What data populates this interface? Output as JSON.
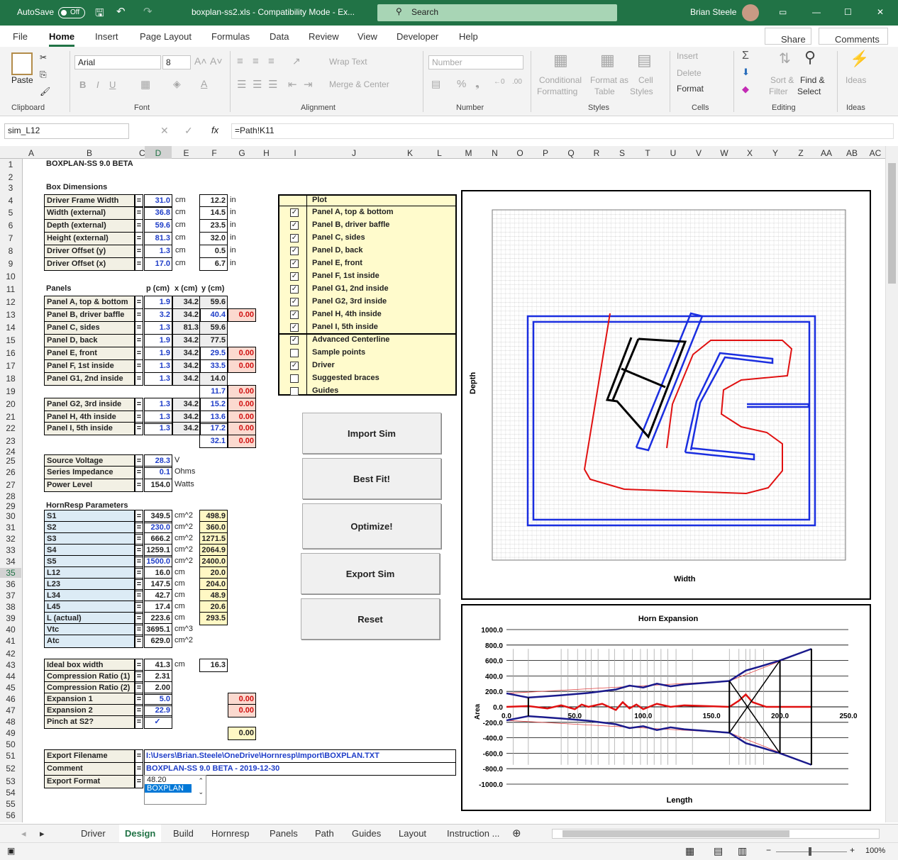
{
  "titlebar": {
    "autosave": "AutoSave",
    "toggle": "Off",
    "doc": "boxplan-ss2.xls  -  Compatibility Mode  -  Ex...",
    "search": "Search",
    "user": "Brian Steele"
  },
  "tabs": [
    "File",
    "Home",
    "Insert",
    "Page Layout",
    "Formulas",
    "Data",
    "Review",
    "View",
    "Developer",
    "Help"
  ],
  "share": "Share",
  "comments": "Comments",
  "ribbon": {
    "paste": "Paste",
    "font": "Arial",
    "size": "8",
    "number_format": "Number",
    "wrap": "Wrap Text",
    "merge": "Merge & Center",
    "cond": [
      "Conditional",
      "Formatting"
    ],
    "fmt_table": [
      "Format as",
      "Table"
    ],
    "cell_styles": [
      "Cell",
      "Styles"
    ],
    "insert": "Insert",
    "delete": "Delete",
    "format": "Format",
    "sort": [
      "Sort &",
      "Filter"
    ],
    "find": [
      "Find &",
      "Select"
    ],
    "ideas": "Ideas",
    "groups": [
      "Clipboard",
      "Font",
      "Alignment",
      "Number",
      "Styles",
      "Cells",
      "Editing",
      "Ideas"
    ]
  },
  "namebox": "sim_L12",
  "formula": "=Path!K11",
  "columns": [
    "A",
    "B",
    "C",
    "D",
    "E",
    "F",
    "G",
    "H",
    "I",
    "J",
    "K",
    "L",
    "M",
    "N",
    "O",
    "P",
    "Q",
    "R",
    "S",
    "T",
    "U",
    "V",
    "W",
    "X",
    "Y",
    "Z",
    "AA",
    "AB",
    "AC"
  ],
  "title": "BOXPLAN-SS 9.0 BETA",
  "box_dims": {
    "header": "Box Dimensions",
    "rows": [
      {
        "label": "Driver Frame Width",
        "cm": "31.0",
        "in": "12.2"
      },
      {
        "label": "Width (external)",
        "cm": "36.8",
        "in": "14.5"
      },
      {
        "label": "Depth (external)",
        "cm": "59.6",
        "in": "23.5"
      },
      {
        "label": "Height (external)",
        "cm": "81.3",
        "in": "32.0"
      },
      {
        "label": "Driver Offset (y)",
        "cm": "1.3",
        "in": "0.5"
      },
      {
        "label": "Driver Offset (x)",
        "cm": "17.0",
        "in": "6.7"
      }
    ],
    "u_cm": "cm",
    "u_in": "in"
  },
  "panels": {
    "header": "Panels",
    "h_p": "p (cm)",
    "h_x": "x (cm)",
    "h_y": "y (cm)",
    "rows": [
      {
        "label": "Panel A, top & bottom",
        "p": "1.9",
        "x": "34.2",
        "y": "59.6",
        "r": ""
      },
      {
        "label": "Panel B, driver baffle",
        "p": "3.2",
        "x": "34.2",
        "y": "40.4",
        "r": "0.00"
      },
      {
        "label": "Panel C, sides",
        "p": "1.3",
        "x": "81.3",
        "y": "59.6",
        "r": ""
      },
      {
        "label": "Panel D, back",
        "p": "1.9",
        "x": "34.2",
        "y": "77.5",
        "r": ""
      },
      {
        "label": "Panel E, front",
        "p": "1.9",
        "x": "34.2",
        "y": "29.5",
        "r": "0.00"
      },
      {
        "label": "Panel F, 1st inside",
        "p": "1.3",
        "x": "34.2",
        "y": "33.5",
        "r": "0.00"
      },
      {
        "label": "Panel G1, 2nd inside",
        "p": "1.3",
        "x": "34.2",
        "y": "14.0",
        "r": ""
      }
    ],
    "row19": {
      "y": "11.7",
      "r": "0.00"
    },
    "rows2": [
      {
        "label": "Panel G2, 3rd inside",
        "p": "1.3",
        "x": "34.2",
        "y": "15.2",
        "r": "0.00"
      },
      {
        "label": "Panel H, 4th inside",
        "p": "1.3",
        "x": "34.2",
        "y": "13.6",
        "r": "0.00"
      },
      {
        "label": "Panel I, 5th inside",
        "p": "1.3",
        "x": "34.2",
        "y": "17.2",
        "r": "0.00"
      }
    ],
    "row23": {
      "y": "32.1",
      "r": "0.00"
    }
  },
  "source": [
    {
      "label": "Source Voltage",
      "v": "28.3",
      "u": "V"
    },
    {
      "label": "Series Impedance",
      "v": "0.1",
      "u": "Ohms"
    },
    {
      "label": "Power Level",
      "v": "154.0",
      "u": "Watts"
    }
  ],
  "hornresp": {
    "header": "HornResp Parameters",
    "rows": [
      {
        "label": "S1",
        "v": "349.5",
        "u": "cm^2",
        "y": "498.9"
      },
      {
        "label": "S2",
        "v": "230.0",
        "u": "cm^2",
        "y": "360.0"
      },
      {
        "label": "S3",
        "v": "666.2",
        "u": "cm^2",
        "y": "1271.5"
      },
      {
        "label": "S4",
        "v": "1259.1",
        "u": "cm^2",
        "y": "2064.9"
      },
      {
        "label": "S5",
        "v": "1500.0",
        "u": "cm^2",
        "y": "2400.0"
      },
      {
        "label": "L12",
        "v": "16.0",
        "u": "cm",
        "y": "20.0"
      },
      {
        "label": "L23",
        "v": "147.5",
        "u": "cm",
        "y": "204.0"
      },
      {
        "label": "L34",
        "v": "42.7",
        "u": "cm",
        "y": "48.9"
      },
      {
        "label": "L45",
        "v": "17.4",
        "u": "cm",
        "y": "20.6"
      },
      {
        "label": "L (actual)",
        "v": "223.6",
        "u": "cm",
        "y": "293.5"
      },
      {
        "label": "Vtc",
        "v": "3695.1",
        "u": "cm^3",
        "y": ""
      },
      {
        "label": "Atc",
        "v": "629.0",
        "u": "cm^2",
        "y": ""
      }
    ]
  },
  "misc": {
    "rows": [
      {
        "label": "Ideal box width",
        "v": "41.3",
        "u": "cm",
        "x": "16.3"
      },
      {
        "label": "Compression Ratio (1)",
        "v": "2.31"
      },
      {
        "label": "Compression Ratio (2)",
        "v": "2.00"
      },
      {
        "label": "Expansion 1",
        "v": "5.0",
        "r": "0.00"
      },
      {
        "label": "Expansion 2",
        "v": "22.9",
        "r": "0.00"
      },
      {
        "label": "Pinch at S2?",
        "v": "✓"
      }
    ],
    "total": "0.00"
  },
  "export": {
    "fn_label": "Export Filename",
    "fn": "I:\\Users\\Brian.Steele\\OneDrive\\Hornresp\\Import\\BOXPLAN.TXT",
    "c_label": "Comment",
    "c": "BOXPLAN-SS 9.0 BETA - 2019-12-30",
    "f_label": "Export Format",
    "opt1": "48.20",
    "opt2": "BOXPLAN"
  },
  "plot_opts": {
    "header": "Plot",
    "items": [
      {
        "label": "Panel A, top & bottom",
        "c": "✓"
      },
      {
        "label": "Panel B, driver baffle",
        "c": "✓"
      },
      {
        "label": "Panel C, sides",
        "c": "✓"
      },
      {
        "label": "Panel D, back",
        "c": "✓"
      },
      {
        "label": "Panel E, front",
        "c": "✓"
      },
      {
        "label": "Panel F, 1st inside",
        "c": "✓"
      },
      {
        "label": "Panel G1, 2nd inside",
        "c": "✓"
      },
      {
        "label": "Panel G2, 3rd inside",
        "c": "✓"
      },
      {
        "label": "Panel H, 4th inside",
        "c": "✓"
      },
      {
        "label": "Panel I, 5th inside",
        "c": "✓"
      },
      {
        "label": "Advanced Centerline",
        "c": "✓"
      },
      {
        "label": "Sample points",
        "c": ""
      },
      {
        "label": "Driver",
        "c": "✓"
      },
      {
        "label": "Suggested braces",
        "c": ""
      },
      {
        "label": "Guides",
        "c": ""
      }
    ]
  },
  "buttons": [
    "Import Sim",
    "Best Fit!",
    "Optimize!",
    "Export Sim",
    "Reset"
  ],
  "layout_plot": {
    "xlabel": "Width",
    "ylabel": "Depth"
  },
  "chart_data": {
    "type": "line",
    "title": "Horn Expansion",
    "xlabel": "Length",
    "ylabel": "Area",
    "xlim": [
      0,
      250
    ],
    "ylim": [
      -1000,
      1000
    ],
    "xticks": [
      "0.0",
      "50.0",
      "100.0",
      "150.0",
      "200.0",
      "250.0"
    ],
    "yticks": [
      "1000.0",
      "800.0",
      "600.0",
      "400.0",
      "200.0",
      "0.0",
      "-200.0",
      "-400.0",
      "-600.0",
      "-800.0",
      "-1000.0"
    ],
    "series": [
      {
        "color": "#1a1a8c",
        "x": [
          0,
          16,
          40,
          60,
          80,
          90,
          100,
          110,
          120,
          130,
          163,
          175,
          185,
          200,
          223
        ],
        "values": [
          175,
          120,
          150,
          180,
          225,
          275,
          250,
          300,
          265,
          290,
          335,
          470,
          520,
          600,
          750
        ]
      },
      {
        "color": "#1a1a8c",
        "x": [
          0,
          16,
          40,
          60,
          80,
          90,
          100,
          110,
          120,
          130,
          163,
          175,
          185,
          200,
          223
        ],
        "values": [
          -175,
          -120,
          -150,
          -180,
          -225,
          -275,
          -250,
          -300,
          -265,
          -290,
          -335,
          -470,
          -520,
          -600,
          -750
        ]
      },
      {
        "color": "#e01010",
        "x": [
          0,
          16,
          30,
          40,
          50,
          55,
          60,
          70,
          80,
          85,
          90,
          95,
          100,
          110,
          120,
          130,
          163,
          170,
          175,
          180,
          190,
          223
        ],
        "values": [
          0,
          10,
          -20,
          20,
          -30,
          30,
          0,
          40,
          -40,
          60,
          -20,
          30,
          -30,
          40,
          0,
          20,
          0,
          80,
          160,
          60,
          0,
          0
        ]
      }
    ]
  },
  "sheets": [
    "Driver",
    "Design",
    "Build",
    "Hornresp",
    "Panels",
    "Path",
    "Guides",
    "Layout",
    "Instruction ..."
  ],
  "zoom": "100%"
}
